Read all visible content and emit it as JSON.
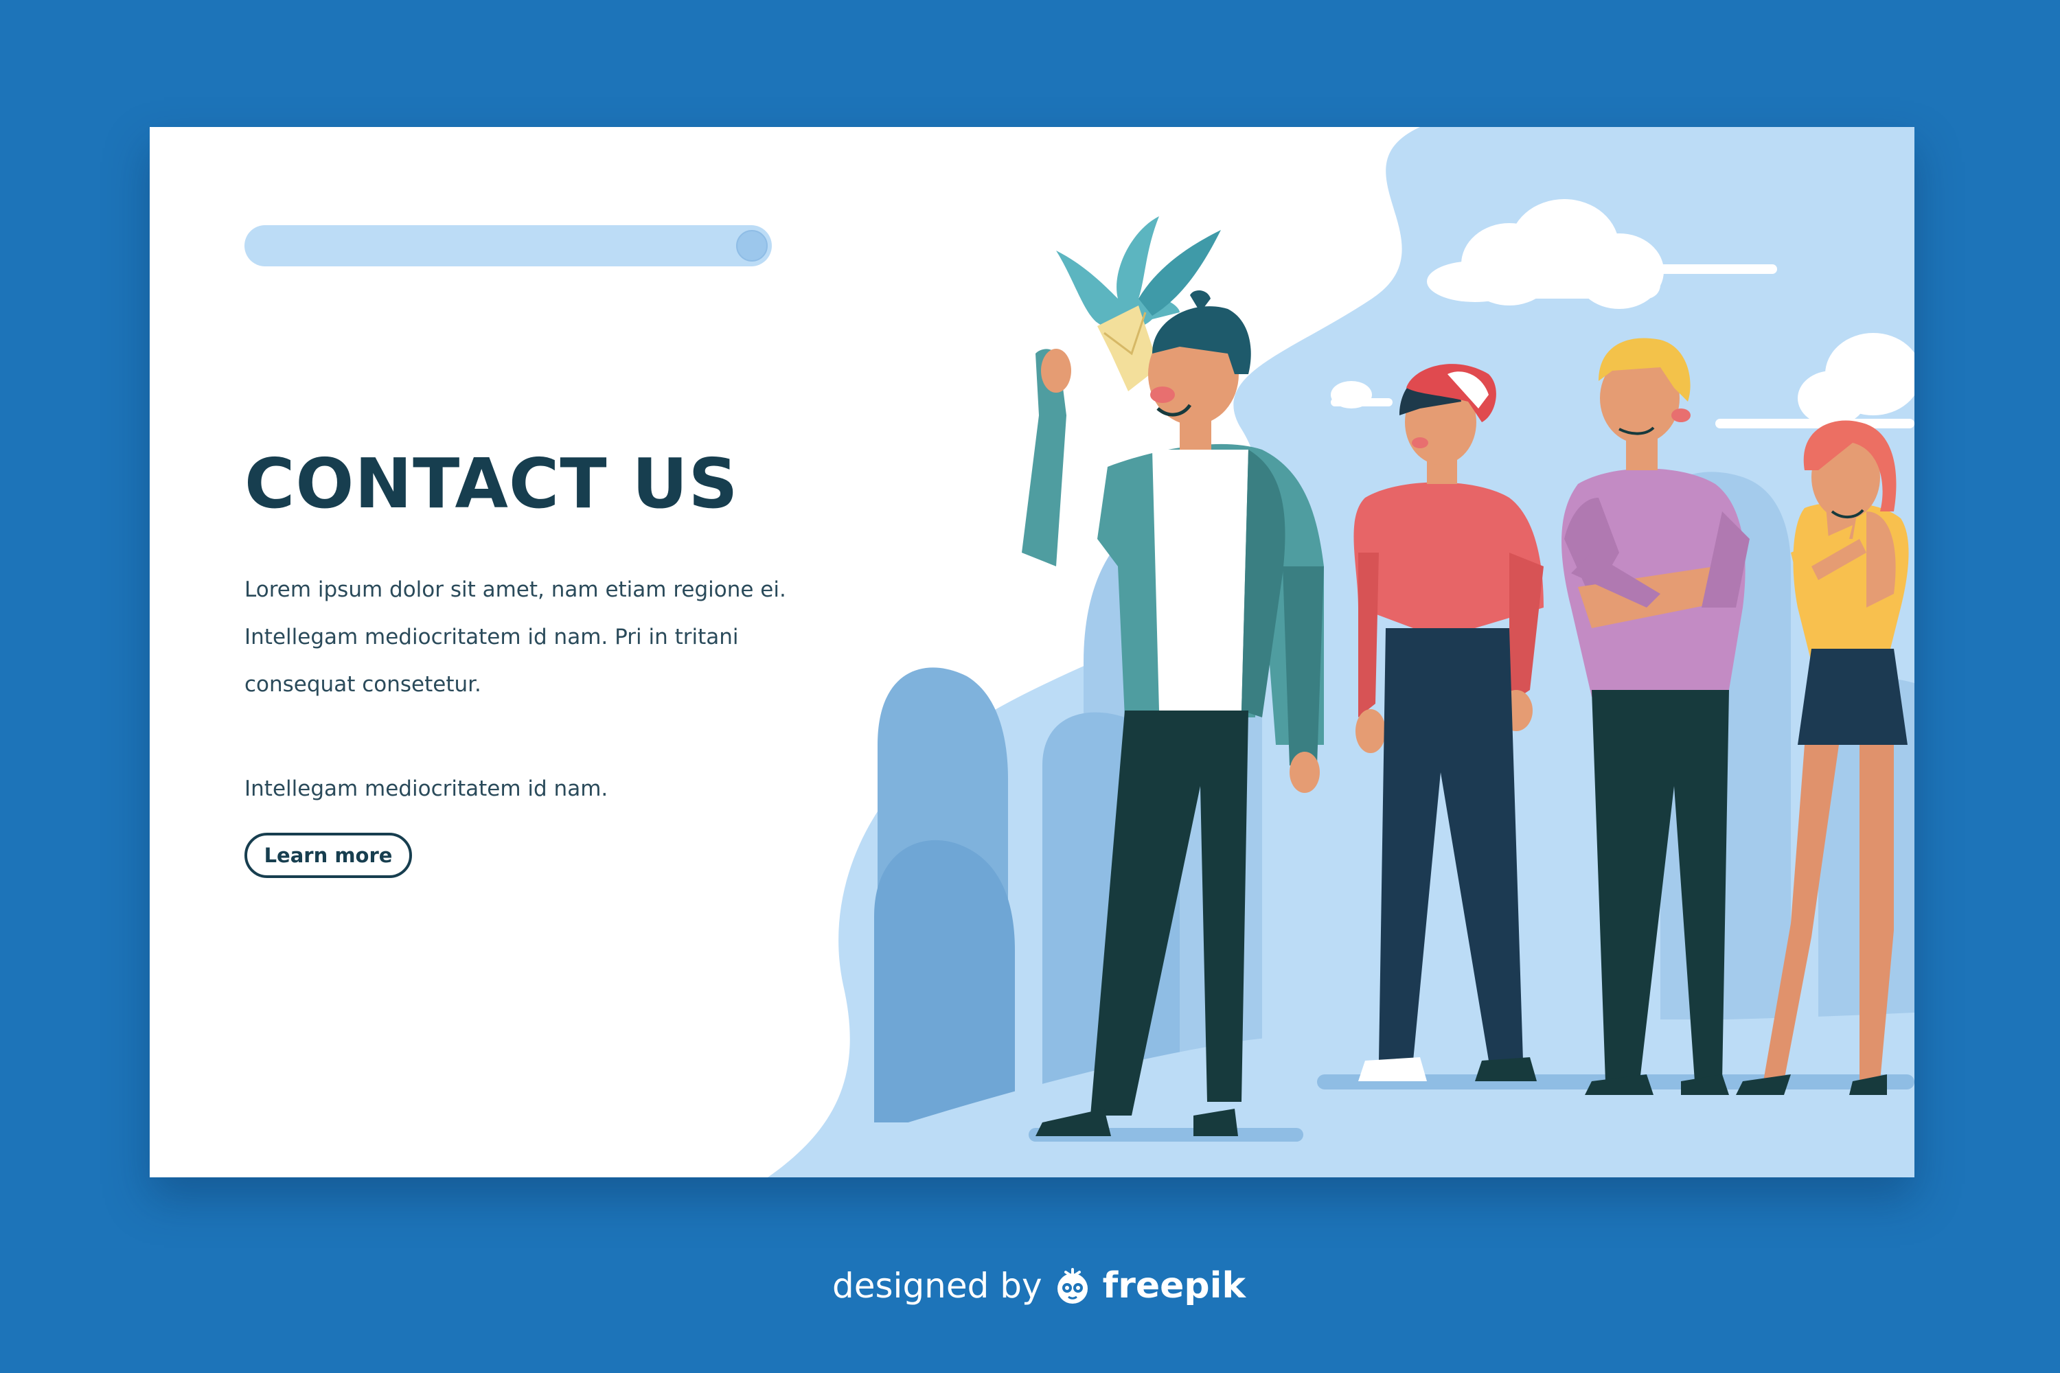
{
  "hero": {
    "title": "CONTACT US",
    "paragraph": "Lorem ipsum dolor sit amet, nam etiam regione ei. Intellegam mediocritatem id nam. Pri in tritani consequat consetetur.",
    "paragraph_2": "Intellegam mediocritatem id nam.",
    "cta_label": "Learn more"
  },
  "footer": {
    "designed_by": "designed by",
    "brand": "freepik",
    "brand_icon": "freepik-logo-icon"
  },
  "colors": {
    "page_background": "#1d74b9",
    "card_background": "#ffffff",
    "heading_text": "#173e4f",
    "search_bar": "#bcdcf6",
    "sky": "#bcdcf6"
  }
}
